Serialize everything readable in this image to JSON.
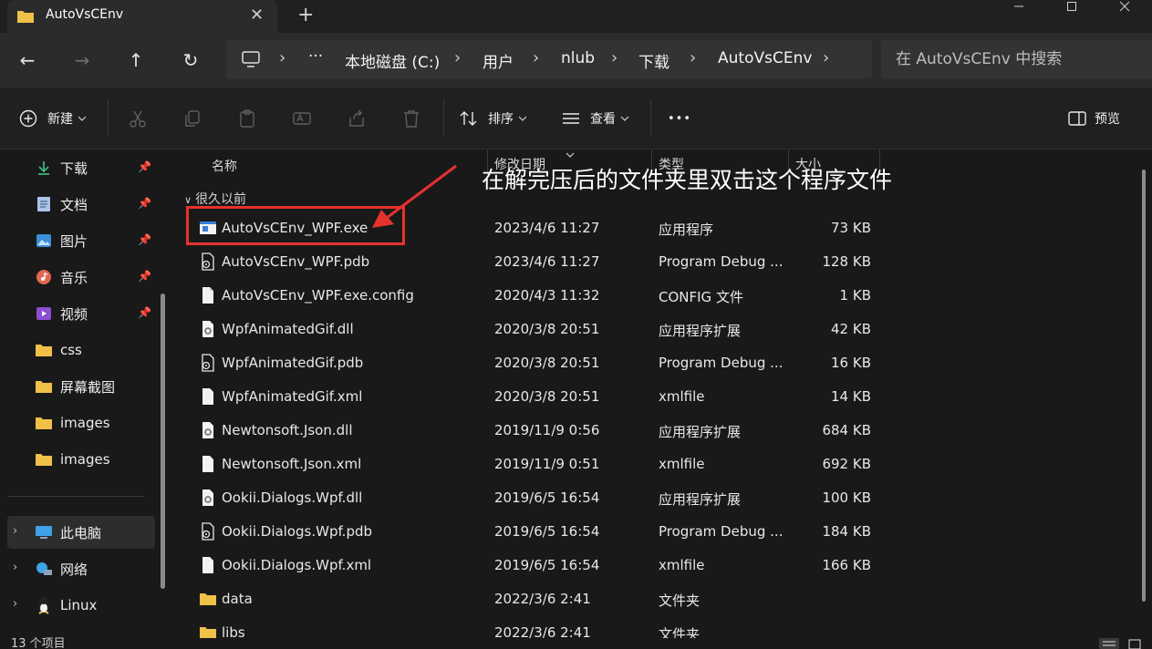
{
  "window": {
    "tab_title": "AutoVsCEnv",
    "tab_close": "✕",
    "new_tab": "+"
  },
  "nav": {
    "back": "←",
    "forward": "→",
    "up": "↑",
    "refresh": "↻"
  },
  "breadcrumb": {
    "overflow": "···",
    "items": [
      "本地磁盘 (C:)",
      "用户",
      "nlub",
      "下载",
      "AutoVsCEnv"
    ],
    "separator": "›"
  },
  "search": {
    "placeholder": "在 AutoVsCEnv 中搜索"
  },
  "toolbar": {
    "new_label": "新建",
    "sort_label": "排序",
    "view_label": "查看",
    "more_label": "•••",
    "preview_label": "预览"
  },
  "sidebar": {
    "quick_access": [
      {
        "label": "下载",
        "icon": "download-icon",
        "pinned": true
      },
      {
        "label": "文档",
        "icon": "document-icon",
        "pinned": true
      },
      {
        "label": "图片",
        "icon": "pictures-icon",
        "pinned": true
      },
      {
        "label": "音乐",
        "icon": "music-icon",
        "pinned": true
      },
      {
        "label": "视频",
        "icon": "video-icon",
        "pinned": true
      },
      {
        "label": "css",
        "icon": "folder-icon",
        "pinned": false
      },
      {
        "label": "屏幕截图",
        "icon": "folder-icon",
        "pinned": false
      },
      {
        "label": "images",
        "icon": "folder-icon",
        "pinned": false
      },
      {
        "label": "images",
        "icon": "folder-icon",
        "pinned": false
      }
    ],
    "locations": [
      {
        "label": "此电脑",
        "icon": "pc-icon"
      },
      {
        "label": "网络",
        "icon": "network-icon"
      },
      {
        "label": "Linux",
        "icon": "linux-icon"
      }
    ]
  },
  "columns": {
    "name": "名称",
    "date": "修改日期",
    "type": "类型",
    "size": "大小"
  },
  "group_label": "很久以前",
  "files": [
    {
      "name": "AutoVsCEnv_WPF.exe",
      "date": "2023/4/6 11:27",
      "type": "应用程序",
      "size": "73 KB",
      "icon": "exe-icon"
    },
    {
      "name": "AutoVsCEnv_WPF.pdb",
      "date": "2023/4/6 11:27",
      "type": "Program Debug ...",
      "size": "128 KB",
      "icon": "pdb-icon"
    },
    {
      "name": "AutoVsCEnv_WPF.exe.config",
      "date": "2020/4/3 11:32",
      "type": "CONFIG 文件",
      "size": "1 KB",
      "icon": "file-icon"
    },
    {
      "name": "WpfAnimatedGif.dll",
      "date": "2020/3/8 20:51",
      "type": "应用程序扩展",
      "size": "42 KB",
      "icon": "dll-icon"
    },
    {
      "name": "WpfAnimatedGif.pdb",
      "date": "2020/3/8 20:51",
      "type": "Program Debug ...",
      "size": "16 KB",
      "icon": "pdb-icon"
    },
    {
      "name": "WpfAnimatedGif.xml",
      "date": "2020/3/8 20:51",
      "type": "xmlfile",
      "size": "14 KB",
      "icon": "file-icon"
    },
    {
      "name": "Newtonsoft.Json.dll",
      "date": "2019/11/9 0:56",
      "type": "应用程序扩展",
      "size": "684 KB",
      "icon": "dll-icon"
    },
    {
      "name": "Newtonsoft.Json.xml",
      "date": "2019/11/9 0:51",
      "type": "xmlfile",
      "size": "692 KB",
      "icon": "file-icon"
    },
    {
      "name": "Ookii.Dialogs.Wpf.dll",
      "date": "2019/6/5 16:54",
      "type": "应用程序扩展",
      "size": "100 KB",
      "icon": "dll-icon"
    },
    {
      "name": "Ookii.Dialogs.Wpf.pdb",
      "date": "2019/6/5 16:54",
      "type": "Program Debug ...",
      "size": "184 KB",
      "icon": "pdb-icon"
    },
    {
      "name": "Ookii.Dialogs.Wpf.xml",
      "date": "2019/6/5 16:54",
      "type": "xmlfile",
      "size": "166 KB",
      "icon": "file-icon"
    },
    {
      "name": "data",
      "date": "2022/3/6 2:41",
      "type": "文件夹",
      "size": "",
      "icon": "folder-icon"
    },
    {
      "name": "libs",
      "date": "2022/3/6 2:41",
      "type": "文件夹",
      "size": "",
      "icon": "folder-icon"
    }
  ],
  "annotation": {
    "text": "在解完压后的文件夹里双击这个程序文件",
    "color": "#e5322d"
  },
  "status": {
    "item_count": "13 个项目"
  },
  "colors": {
    "background": "#191919",
    "toolbar": "#202020",
    "address_bar": "#333333",
    "folder": "#f0c048",
    "accent": "#e5322d"
  }
}
